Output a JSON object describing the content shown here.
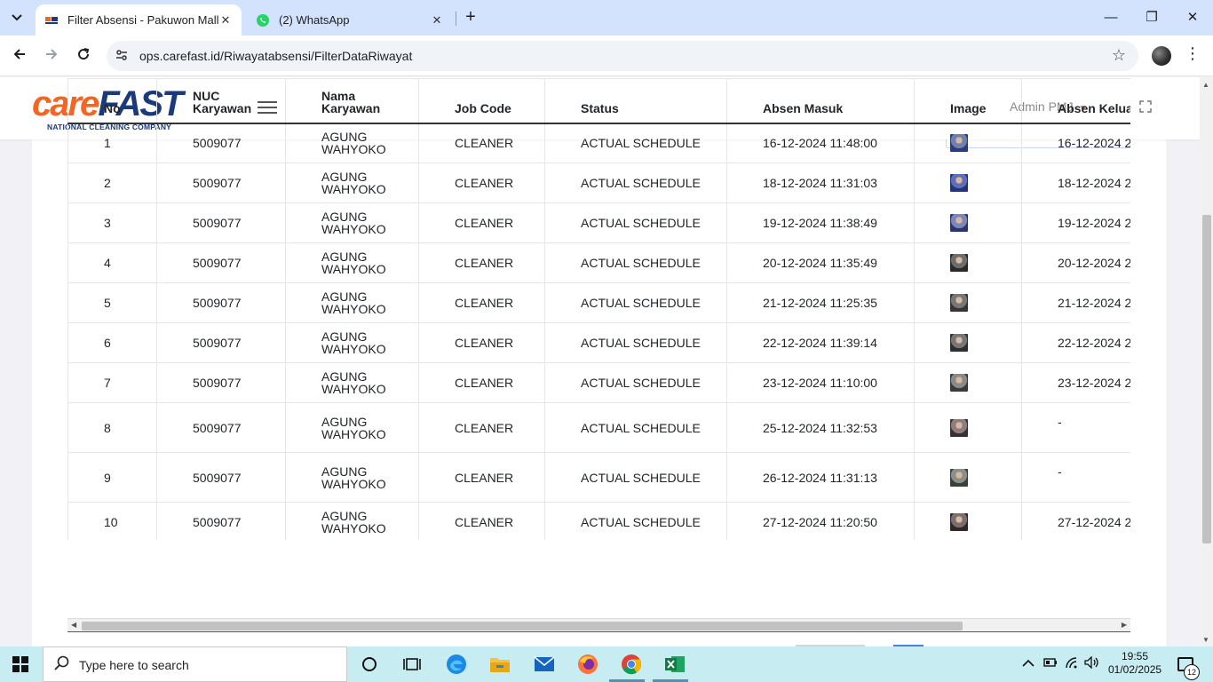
{
  "browser": {
    "tabs": [
      {
        "title": "Filter Absensi - Pakuwon Mall Y",
        "close": "✕"
      },
      {
        "title": "(2) WhatsApp",
        "close": "✕"
      }
    ],
    "new_tab": "+",
    "url": "ops.carefast.id/Riwayatabsensi/FilterDataRiwayat",
    "window_controls": {
      "minimize": "—",
      "restore": "❐",
      "close": "✕"
    }
  },
  "header": {
    "logo_care": "care",
    "logo_fast": "FAST",
    "logo_tagline": "NATIONAL CLEANING COMPANY",
    "user": "Admin PMJ"
  },
  "table": {
    "columns": {
      "no": "No",
      "nuc_1": "NUC",
      "nuc_2": "Karyawan",
      "nama_1": "Nama",
      "nama_2": "Karyawan",
      "job": "Job Code",
      "status": "Status",
      "masuk": "Absen Masuk",
      "image": "Image",
      "keluar": "Absen Keluar"
    },
    "rows": [
      {
        "no": "1",
        "nuc": "5009077",
        "nama_1": "AGUNG",
        "nama_2": "WAHYOKO",
        "job": "CLEANER",
        "status": "ACTUAL SCHEDULE",
        "masuk": "16-12-2024 11:48:00",
        "keluar": "16-12-2024 2"
      },
      {
        "no": "2",
        "nuc": "5009077",
        "nama_1": "AGUNG",
        "nama_2": "WAHYOKO",
        "job": "CLEANER",
        "status": "ACTUAL SCHEDULE",
        "masuk": "18-12-2024 11:31:03",
        "keluar": "18-12-2024 2"
      },
      {
        "no": "3",
        "nuc": "5009077",
        "nama_1": "AGUNG",
        "nama_2": "WAHYOKO",
        "job": "CLEANER",
        "status": "ACTUAL SCHEDULE",
        "masuk": "19-12-2024 11:38:49",
        "keluar": "19-12-2024 2"
      },
      {
        "no": "4",
        "nuc": "5009077",
        "nama_1": "AGUNG",
        "nama_2": "WAHYOKO",
        "job": "CLEANER",
        "status": "ACTUAL SCHEDULE",
        "masuk": "20-12-2024 11:35:49",
        "keluar": "20-12-2024 2"
      },
      {
        "no": "5",
        "nuc": "5009077",
        "nama_1": "AGUNG",
        "nama_2": "WAHYOKO",
        "job": "CLEANER",
        "status": "ACTUAL SCHEDULE",
        "masuk": "21-12-2024 11:25:35",
        "keluar": "21-12-2024 2"
      },
      {
        "no": "6",
        "nuc": "5009077",
        "nama_1": "AGUNG",
        "nama_2": "WAHYOKO",
        "job": "CLEANER",
        "status": "ACTUAL SCHEDULE",
        "masuk": "22-12-2024 11:39:14",
        "keluar": "22-12-2024 2"
      },
      {
        "no": "7",
        "nuc": "5009077",
        "nama_1": "AGUNG",
        "nama_2": "WAHYOKO",
        "job": "CLEANER",
        "status": "ACTUAL SCHEDULE",
        "masuk": "23-12-2024 11:10:00",
        "keluar": "23-12-2024 2"
      },
      {
        "no": "8",
        "nuc": "5009077",
        "nama_1": "AGUNG",
        "nama_2": "WAHYOKO",
        "job": "CLEANER",
        "status": "ACTUAL SCHEDULE",
        "masuk": "25-12-2024 11:32:53",
        "keluar": "-"
      },
      {
        "no": "9",
        "nuc": "5009077",
        "nama_1": "AGUNG",
        "nama_2": "WAHYOKO",
        "job": "CLEANER",
        "status": "ACTUAL SCHEDULE",
        "masuk": "26-12-2024 11:31:13",
        "keluar": "-"
      },
      {
        "no": "10",
        "nuc": "5009077",
        "nama_1": "AGUNG",
        "nama_2": "WAHYOKO",
        "job": "CLEANER",
        "status": "ACTUAL SCHEDULE",
        "masuk": "27-12-2024 11:20:50",
        "keluar": "27-12-2024 2"
      }
    ]
  },
  "taskbar": {
    "search_placeholder": "Type here to search",
    "time": "19:55",
    "date": "01/02/2025",
    "notifications": "12"
  },
  "colors": {
    "brand_orange": "#f26522",
    "brand_navy": "#1b3a7a",
    "tabbar": "#d3e3fd",
    "taskbar": "#c7ecf2"
  },
  "icons": [
    "tab-search-icon",
    "carefast-favicon-icon",
    "whatsapp-icon",
    "back-icon",
    "forward-icon",
    "reload-icon",
    "site-info-icon",
    "bookmark-star-icon",
    "menu-kebab-icon",
    "hamburger-icon",
    "fullscreen-icon",
    "windows-start-icon",
    "search-icon",
    "task-view-icon",
    "edge-icon",
    "file-explorer-icon",
    "mail-icon",
    "firefox-icon",
    "chrome-icon",
    "excel-icon"
  ]
}
